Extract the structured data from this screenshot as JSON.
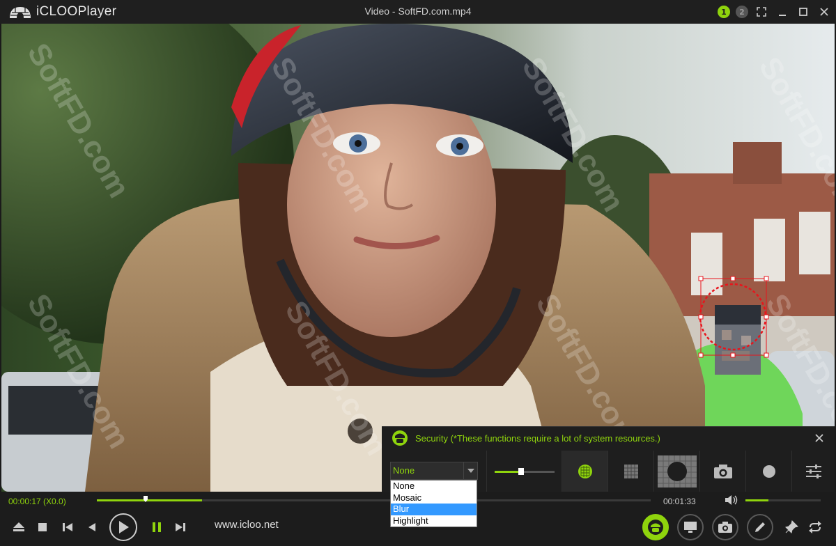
{
  "app": {
    "logo_text": "iCLOOPlayer",
    "window_title": "Video - SoftFD.com.mp4",
    "screen_badges": [
      "1",
      "2"
    ]
  },
  "video": {
    "watermark": "SoftFD.com"
  },
  "security": {
    "title": "Security (*These functions require a lot of system resources.)",
    "mode_value": "None",
    "mode_options": [
      "None",
      "Mosaic",
      "Blur",
      "Highlight"
    ],
    "highlighted_option": "Blur"
  },
  "playback": {
    "current_time": "00:00:17 (X0.0)",
    "total_time": "00:01:33",
    "website": "www.icloo.net",
    "progress_fraction": 0.19,
    "played_thumb_fraction": 0.088,
    "volume_fraction": 0.31
  },
  "colors": {
    "accent": "#8fd40d",
    "highlight_blue": "#3399ff",
    "selection_red": "#e8141c"
  }
}
